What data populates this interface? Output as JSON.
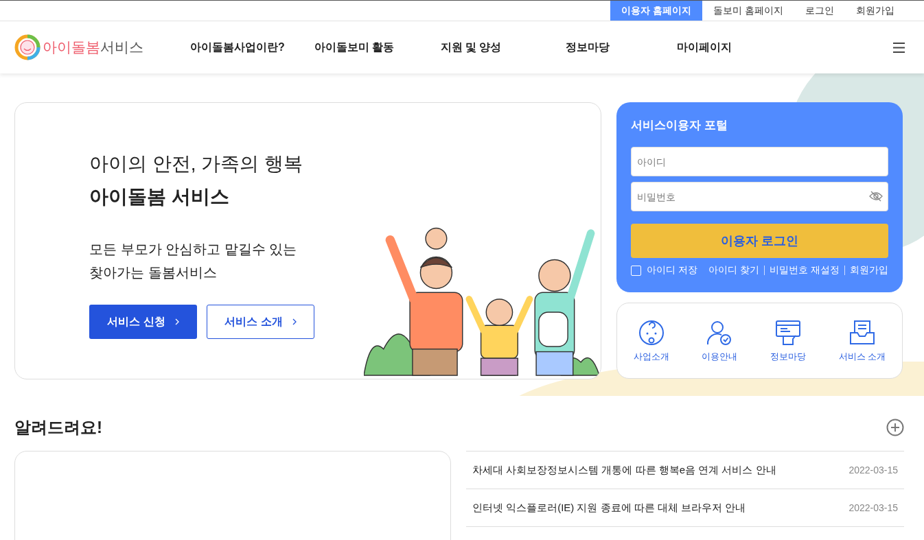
{
  "top_links": [
    {
      "label": "이용자 홈페이지",
      "selected": true
    },
    {
      "label": "돌보미 홈페이지",
      "selected": false
    },
    {
      "label": "로그인",
      "selected": false
    },
    {
      "label": "회원가입",
      "selected": false
    }
  ],
  "logo": {
    "accent": "아이돌봄",
    "rest": "서비스"
  },
  "nav": [
    "아이돌봄사업이란?",
    "아이돌보미 활동",
    "지원 및 양성",
    "정보마당",
    "마이페이지"
  ],
  "hero": {
    "title": "아이의 안전, 가족의 행복",
    "headline": "아이돌봄 서비스",
    "description_lines": [
      "모든 부모가 안심하고 맡길수 있는",
      "찾아가는 돌봄서비스"
    ],
    "buttons": [
      {
        "label": "서비스 신청",
        "kind": "primary"
      },
      {
        "label": "서비스 소개",
        "kind": "outline"
      }
    ]
  },
  "login": {
    "title": "서비스이용자 포털",
    "id_placeholder": "아이디",
    "password_placeholder": "비밀번호",
    "submit": "이용자 로그인",
    "remember": {
      "label": "아이디 저장",
      "checked": false
    },
    "links": [
      "아이디 찾기",
      "비밀번호 재설정",
      "회원가입"
    ]
  },
  "quick_links": [
    {
      "label": "사업소개",
      "kind": "baby"
    },
    {
      "label": "이용안내",
      "kind": "user-check"
    },
    {
      "label": "정보마당",
      "kind": "board"
    },
    {
      "label": "서비스 소개",
      "kind": "inbox"
    }
  ],
  "notices": {
    "title": "알려드려요!",
    "items": [
      {
        "title": "차세대 사회보장정보시스템 개통에 따른 행복e음 연계 서비스 안내",
        "date": "2022-03-15"
      },
      {
        "title": "인터넷 익스플로러(IE) 지원 종료에 따른 대체 브라우저 안내",
        "date": "2022-03-15"
      }
    ]
  }
}
